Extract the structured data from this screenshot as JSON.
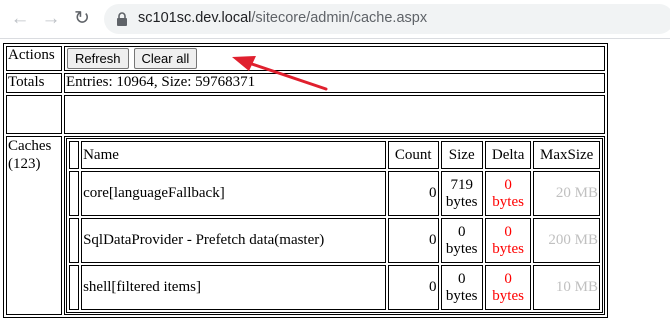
{
  "browser": {
    "url_host": "sc101sc.dev.local",
    "url_path": "/sitecore/admin/cache.aspx"
  },
  "page": {
    "actions_label": "Actions",
    "refresh_label": "Refresh",
    "clear_all_label": "Clear all",
    "totals_label": "Totals",
    "totals_text": "Entries: 10964, Size: 59768371",
    "caches_label": "Caches",
    "caches_count": "(123)"
  },
  "table": {
    "headers": [
      "Name",
      "Count",
      "Size",
      "Delta",
      "MaxSize"
    ],
    "rows": [
      {
        "name": "core[languageFallback]",
        "count": "0",
        "size_value": "719",
        "size_unit": "bytes",
        "delta_value": "0",
        "delta_unit": "bytes",
        "max": "20 MB"
      },
      {
        "name": "SqlDataProvider - Prefetch data(master)",
        "count": "0",
        "size_value": "0",
        "size_unit": "bytes",
        "delta_value": "0",
        "delta_unit": "bytes",
        "max": "200 MB"
      },
      {
        "name": "shell[filtered items]",
        "count": "0",
        "size_value": "0",
        "size_unit": "bytes",
        "delta_value": "0",
        "delta_unit": "bytes",
        "max": "10 MB"
      }
    ]
  },
  "colors": {
    "annotation_arrow": "#e0202e",
    "delta_red": "#ff0000",
    "maxsize_gray": "#c0c0c0"
  }
}
